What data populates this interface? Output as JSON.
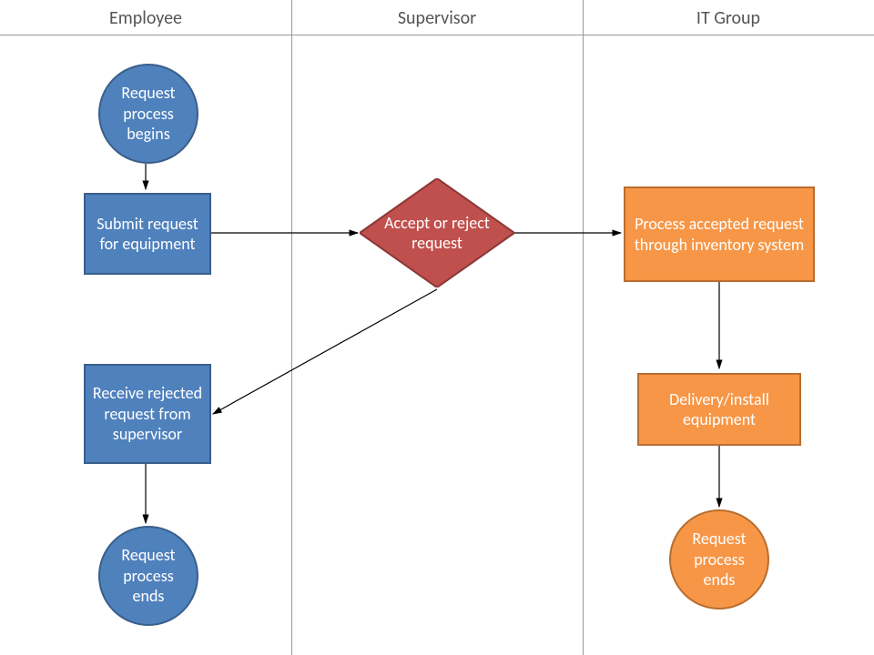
{
  "lanes": {
    "employee": "Employee",
    "supervisor": "Supervisor",
    "it_group": "IT Group"
  },
  "nodes": {
    "start": "Request process begins",
    "submit": "Submit request for equipment",
    "decision": "Accept or reject request",
    "process": "Process accepted request through inventory system",
    "receive_reject": "Receive rejected request from supervisor",
    "delivery": "Delivery/install equipment",
    "end_emp": "Request process ends",
    "end_it": "Request process ends"
  },
  "colors": {
    "blue": "#4f81bd",
    "orange": "#f79646",
    "red": "#c0504d"
  }
}
